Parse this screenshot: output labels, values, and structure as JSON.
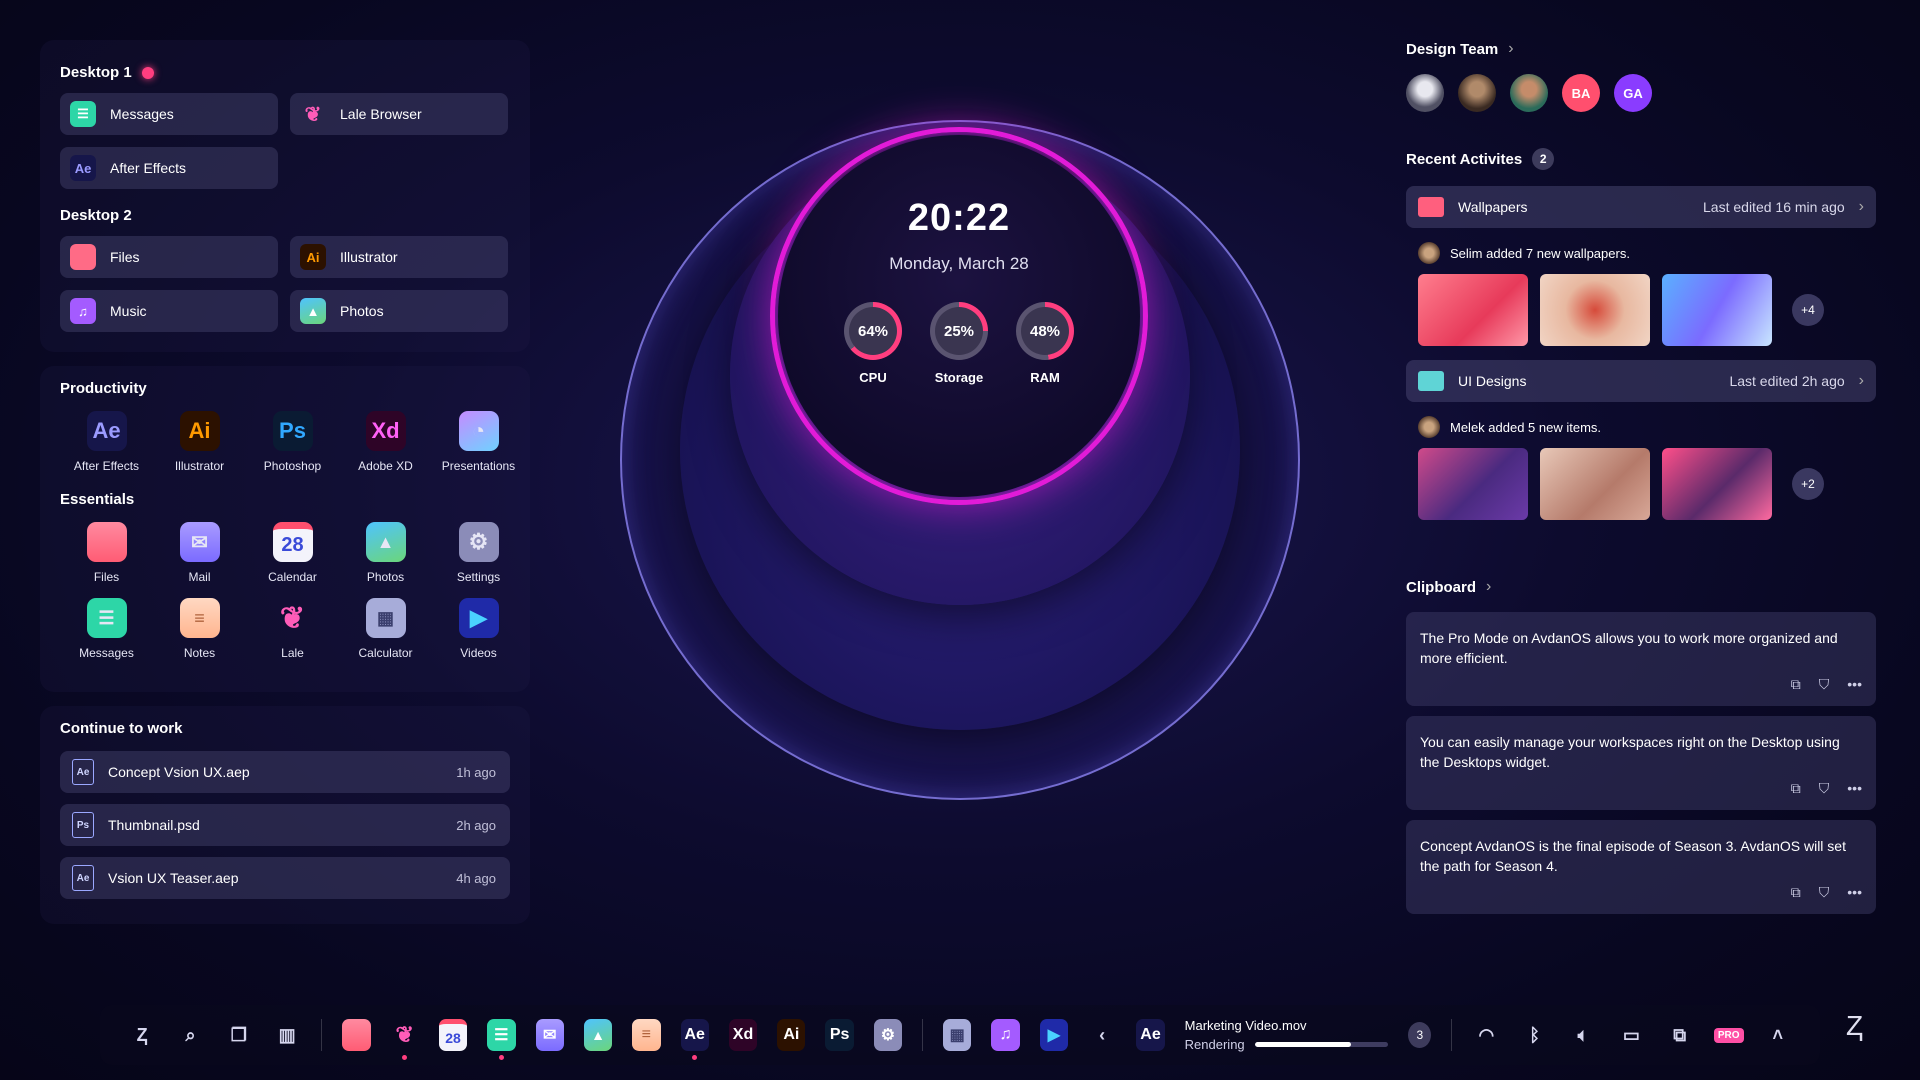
{
  "desktops": [
    {
      "title": "Desktop 1",
      "items": [
        {
          "label": "Messages",
          "icon": "messages-icon"
        },
        {
          "label": "Lale Browser",
          "icon": "lale-icon"
        },
        {
          "label": "After Effects",
          "icon": "after-effects-icon"
        }
      ]
    },
    {
      "title": "Desktop 2",
      "items": [
        {
          "label": "Files",
          "icon": "folder-icon"
        },
        {
          "label": "Illustrator",
          "icon": "illustrator-icon"
        },
        {
          "label": "Music",
          "icon": "music-icon"
        },
        {
          "label": "Photos",
          "icon": "photos-icon"
        }
      ]
    }
  ],
  "productivity": {
    "title": "Productivity",
    "apps": [
      {
        "label": "After Effects",
        "abbr": "Ae"
      },
      {
        "label": "Illustrator",
        "abbr": "Ai"
      },
      {
        "label": "Photoshop",
        "abbr": "Ps"
      },
      {
        "label": "Adobe XD",
        "abbr": "Xd"
      },
      {
        "label": "Presentations",
        "icon": "presentation-icon"
      }
    ]
  },
  "essentials": {
    "title": "Essentials",
    "apps": [
      {
        "label": "Files",
        "icon": "folder-icon"
      },
      {
        "label": "Mail",
        "icon": "mail-icon"
      },
      {
        "label": "Calendar",
        "icon": "calendar-icon",
        "day": "28"
      },
      {
        "label": "Photos",
        "icon": "photos-icon"
      },
      {
        "label": "Settings",
        "icon": "gear-icon"
      },
      {
        "label": "Messages",
        "icon": "messages-icon"
      },
      {
        "label": "Notes",
        "icon": "notes-icon"
      },
      {
        "label": "Lale",
        "icon": "lale-icon"
      },
      {
        "label": "Calculator",
        "icon": "calculator-icon"
      },
      {
        "label": "Videos",
        "icon": "play-icon"
      }
    ]
  },
  "continue": {
    "title": "Continue to work",
    "items": [
      {
        "name": "Concept Vsion UX.aep",
        "ago": "1h ago",
        "type": "Ae"
      },
      {
        "name": "Thumbnail.psd",
        "ago": "2h ago",
        "type": "Ps"
      },
      {
        "name": "Vsion UX Teaser.aep",
        "ago": "4h ago",
        "type": "Ae"
      }
    ]
  },
  "clock": {
    "time": "20:22",
    "date": "Monday, March 28"
  },
  "gauges": [
    {
      "label": "CPU",
      "value": 64,
      "text": "64%"
    },
    {
      "label": "Storage",
      "value": 25,
      "text": "25%"
    },
    {
      "label": "RAM",
      "value": 48,
      "text": "48%"
    }
  ],
  "team": {
    "title": "Design Team",
    "members": [
      "",
      "",
      "",
      "BA",
      "GA"
    ]
  },
  "recent": {
    "title": "Recent Activites",
    "count": "2",
    "groups": [
      {
        "folder": "Wallpapers",
        "edited": "Last edited 16 min ago",
        "note": "Selim added 7 new wallpapers.",
        "more": "+4",
        "folder_color": "#ff5f7e"
      },
      {
        "folder": "UI Designs",
        "edited": "Last edited 2h ago",
        "note": "Melek added 5 new items.",
        "more": "+2",
        "folder_color": "#5fd4d6"
      }
    ]
  },
  "clipboard": {
    "title": "Clipboard",
    "items": [
      "The Pro Mode on AvdanOS allows you to work more organized and more efficient.",
      "You can easily manage your workspaces right on the Desktop using the Desktops widget.",
      "Concept AvdanOS is the final episode of Season 3. AvdanOS will set the path for Season 4."
    ]
  },
  "dock": {
    "render_title": "Marketing Video.mov",
    "render_status": "Rendering",
    "render_progress": 0.72,
    "queue_count": "3",
    "pro_label": "PRO",
    "calendar_day": "28"
  },
  "colors": {
    "accent": "#ff3e7f",
    "ring_blue": "#6f6cff",
    "ring_pink": "#e21bd8"
  }
}
